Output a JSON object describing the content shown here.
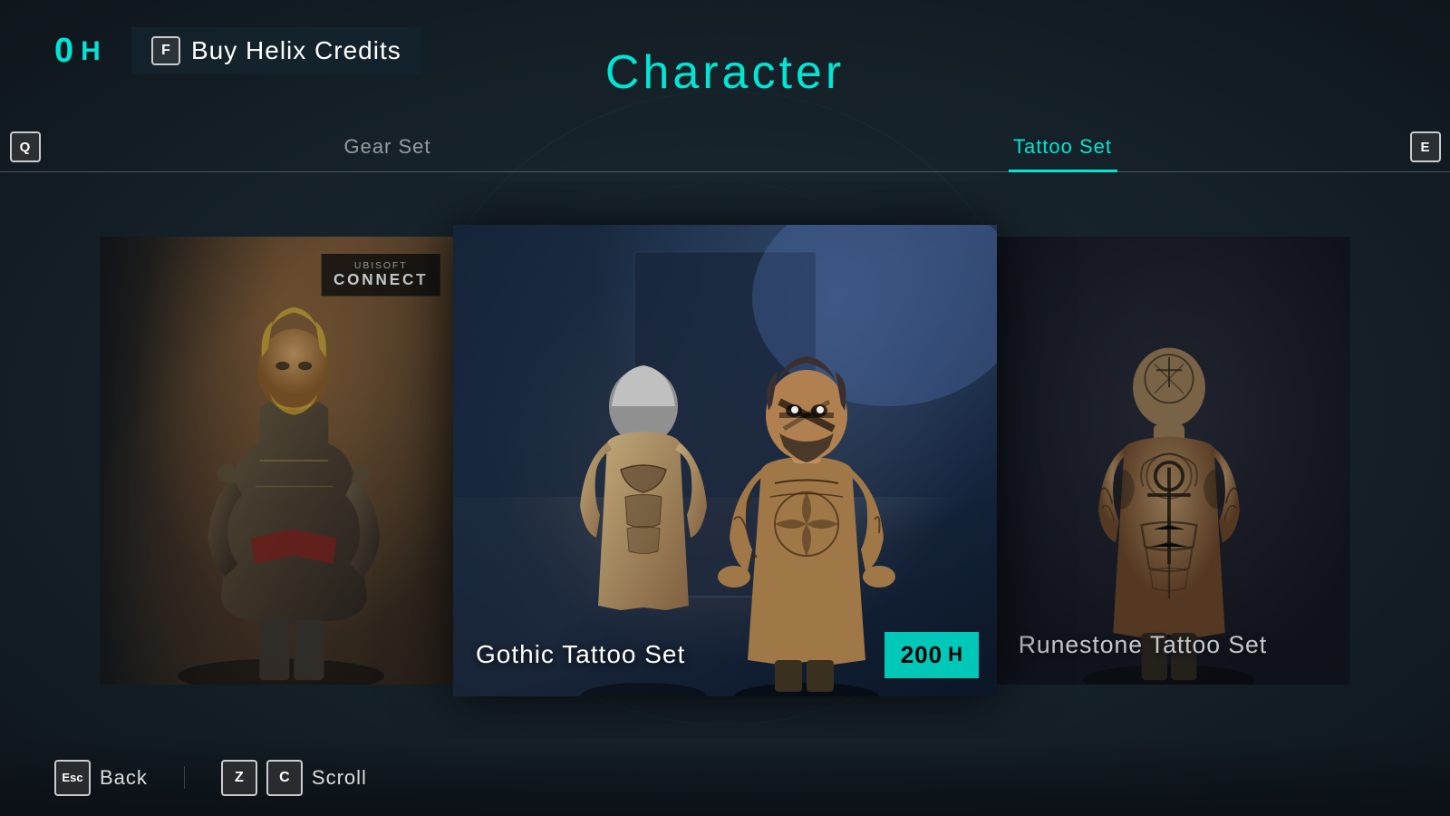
{
  "page": {
    "title": "Character",
    "helix_balance": "0",
    "helix_symbol": "H"
  },
  "header": {
    "balance_display": "0 H",
    "buy_button": {
      "key": "F",
      "label": "Buy Helix Credits"
    }
  },
  "tabs": {
    "left_key": "Q",
    "right_key": "E",
    "items": [
      {
        "id": "gear-set",
        "label": "Gear Set",
        "active": false
      },
      {
        "id": "tattoo-set",
        "label": "Tattoo Set",
        "active": true
      }
    ]
  },
  "cards": [
    {
      "id": "left-card",
      "type": "character",
      "badge": {
        "line1": "UBISOFT",
        "line2": "CONNECT"
      },
      "name": null,
      "price": null
    },
    {
      "id": "center-card",
      "type": "tattoo",
      "name": "Gothic Tattoo Set",
      "price": "200",
      "price_symbol": "H"
    },
    {
      "id": "right-card",
      "type": "tattoo",
      "name": "Runestone Tattoo Set",
      "price": null
    }
  ],
  "bottom_bar": {
    "actions": [
      {
        "id": "back",
        "key": "Esc",
        "label": "Back"
      },
      {
        "id": "scroll",
        "keys": [
          "Z",
          "C"
        ],
        "label": "Scroll"
      }
    ]
  },
  "colors": {
    "accent": "#00e5d4",
    "accent_dark": "#00c8b8",
    "bg_dark": "#111820",
    "text_muted": "rgba(255,255,255,0.55)"
  }
}
